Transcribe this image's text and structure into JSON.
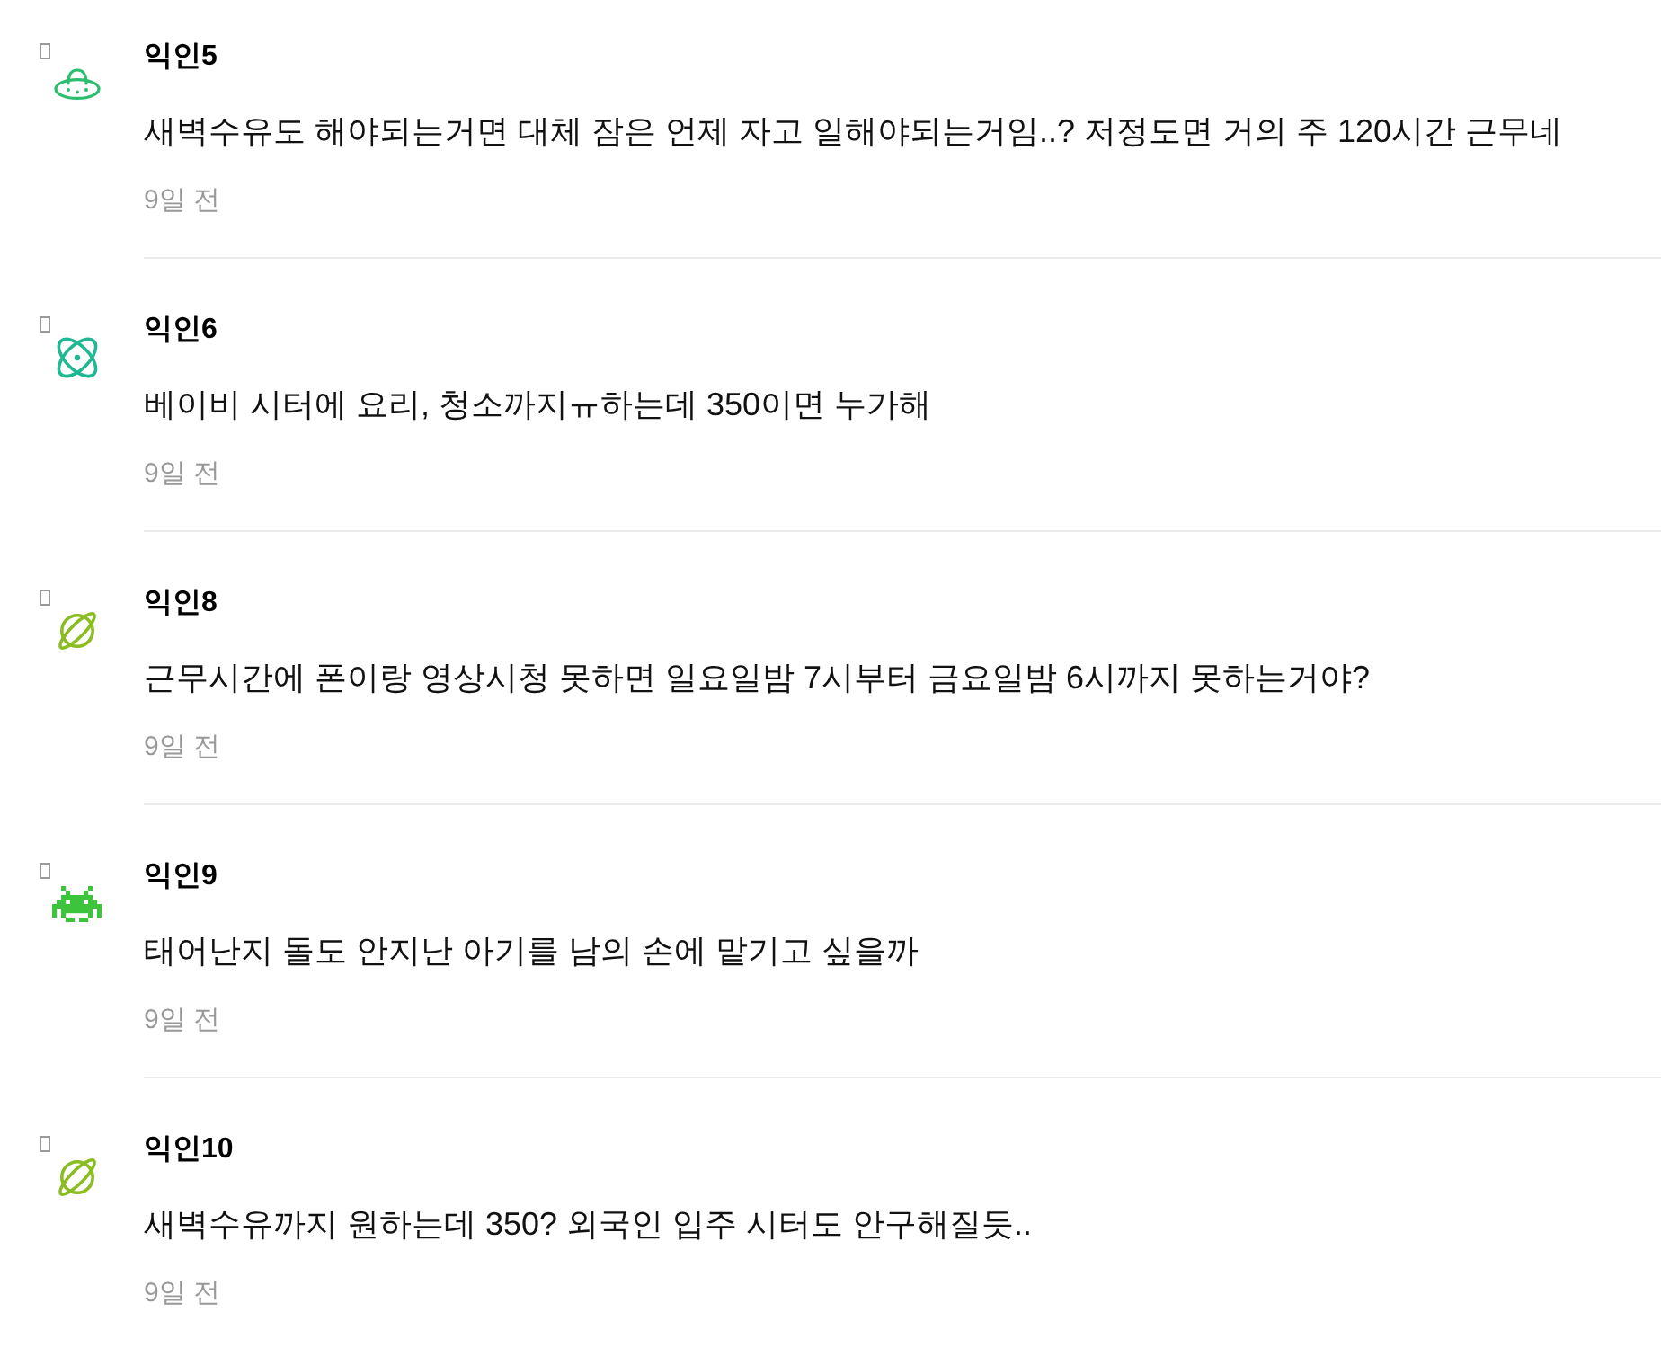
{
  "comments": [
    {
      "author": "익인5",
      "avatar": {
        "kind": "ufo",
        "color": "#2dbd6e"
      },
      "text": "새벽수유도 해야되는거면 대체 잠은 언제 자고 일해야되는거임..? 저정도면 거의 주 120시간 근무네",
      "time": "9일 전"
    },
    {
      "author": "익인6",
      "avatar": {
        "kind": "atom",
        "color": "#1fb893"
      },
      "text": "베이비 시터에 요리, 청소까지ㅠ하는데 350이면 누가해",
      "time": "9일 전"
    },
    {
      "author": "익인8",
      "avatar": {
        "kind": "planet",
        "color": "#8bbd22"
      },
      "text": "근무시간에 폰이랑 영상시청 못하면 일요일밤 7시부터 금요일밤 6시까지 못하는거야?",
      "time": "9일 전"
    },
    {
      "author": "익인9",
      "avatar": {
        "kind": "invader",
        "color": "#3cc43c"
      },
      "text": "태어난지 돌도 안지난 아기를 남의 손에 맡기고 싶을까",
      "time": "9일 전"
    },
    {
      "author": "익인10",
      "avatar": {
        "kind": "planet",
        "color": "#8bbd22"
      },
      "text": "새벽수유까지 원하는데 350? 외국인 입주 시터도 안구해질듯..",
      "time": "9일 전"
    }
  ]
}
